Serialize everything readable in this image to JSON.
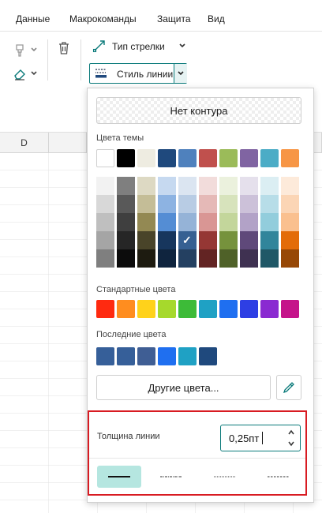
{
  "menu": {
    "items": [
      "Данные",
      "Макрокоманды",
      "Защита",
      "Вид"
    ]
  },
  "toolbar": {
    "arrow_type_label": "Тип стрелки",
    "line_style_label": "Стиль линии"
  },
  "sheet": {
    "column_header": "D"
  },
  "dropdown": {
    "no_contour_label": "Нет контура",
    "theme_colors_label": "Цвета темы",
    "theme_colors": [
      "#ffffff",
      "#000000",
      "#eeece1",
      "#1f497d",
      "#4f81bd",
      "#c0504d",
      "#9bbb59",
      "#8064a2",
      "#4bacc6",
      "#f79646"
    ],
    "theme_shades": [
      [
        "#f2f2f2",
        "#7f7f7f",
        "#ddd9c3",
        "#c6d9f0",
        "#dbe5f1",
        "#f2dcdb",
        "#ebf1dd",
        "#e5e0ec",
        "#dbeef3",
        "#fdeada"
      ],
      [
        "#d8d8d8",
        "#595959",
        "#c4bd97",
        "#8db3e2",
        "#b8cce4",
        "#e5b9b7",
        "#d7e3bc",
        "#ccc1d9",
        "#b7dde8",
        "#fbd5b5"
      ],
      [
        "#bfbfbf",
        "#3f3f3f",
        "#938953",
        "#548dd4",
        "#95b3d7",
        "#d99694",
        "#c3d69b",
        "#b2a2c7",
        "#92cddc",
        "#fac08f"
      ],
      [
        "#a5a5a5",
        "#262626",
        "#494429",
        "#17365d",
        "#366092",
        "#953734",
        "#76923c",
        "#5f497a",
        "#31859b",
        "#e36c09"
      ],
      [
        "#7f7f7f",
        "#0c0c0c",
        "#1d1b10",
        "#0f243e",
        "#244061",
        "#632423",
        "#4f6128",
        "#3f3151",
        "#205867",
        "#974806"
      ]
    ],
    "selected_shade": {
      "row": 3,
      "col": 4
    },
    "standard_colors_label": "Стандартные цвета",
    "standard_colors": [
      "#ff2a10",
      "#ff8d1f",
      "#ffd21b",
      "#a6d92c",
      "#3dbb38",
      "#1fa1c4",
      "#1f6ff0",
      "#2e3fe4",
      "#8a2ad1",
      "#c5148a"
    ],
    "recent_colors_label": "Последние цвета",
    "recent_colors": [
      "#365f99",
      "#365f99",
      "#3f5e94",
      "#1f6ff0",
      "#1fa1c4",
      "#1f497d"
    ],
    "other_colors_label": "Другие цвета...",
    "thickness_label": "Толщина линии",
    "thickness_value": "0,25пт",
    "line_styles": [
      "solid",
      "dash-dot",
      "dotted",
      "dashed"
    ],
    "accent_color": "#0a7a7a",
    "highlight_color": "#d81b22"
  }
}
